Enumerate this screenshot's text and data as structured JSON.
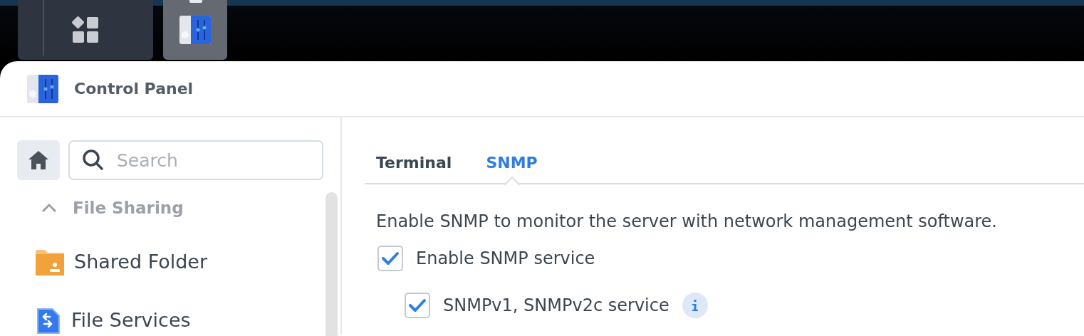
{
  "taskbar": {
    "items": [
      {
        "kind": "apps",
        "selected": false
      },
      {
        "kind": "control-panel",
        "selected": true
      }
    ]
  },
  "window": {
    "title": "Control Panel"
  },
  "sidebar": {
    "search": {
      "placeholder": "Search"
    },
    "sections": [
      {
        "label": "File Sharing",
        "expanded": true,
        "items": [
          {
            "label": "Shared Folder",
            "kind": "folder"
          },
          {
            "label": "File Services",
            "kind": "file-services"
          }
        ]
      }
    ]
  },
  "tabs": [
    {
      "label": "Terminal",
      "selected": false
    },
    {
      "label": "SNMP",
      "selected": true
    }
  ],
  "description": "Enable SNMP to monitor the server with network management software.",
  "options": [
    {
      "label": "Enable SNMP service",
      "checked": true,
      "children": [
        {
          "label": "SNMPv1, SNMPv2c service",
          "checked": true,
          "info": true
        }
      ]
    }
  ]
}
